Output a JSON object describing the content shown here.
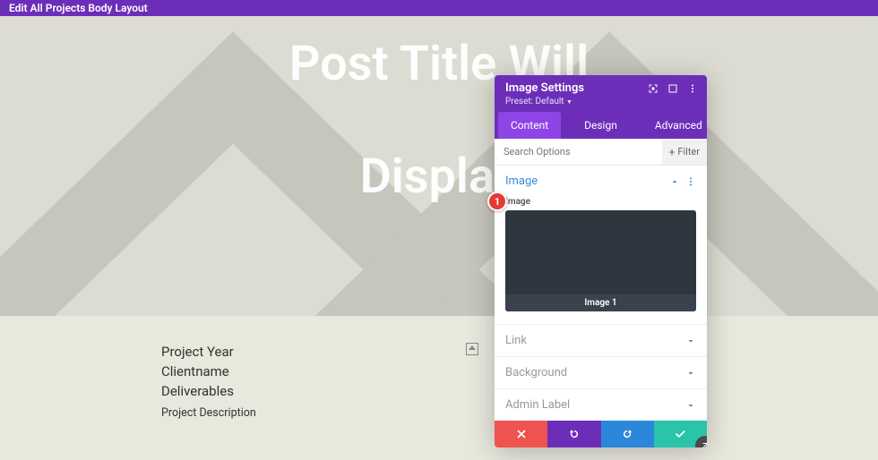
{
  "topbar": {
    "title": "Edit All Projects Body Layout"
  },
  "hero": {
    "line1": "Post Title Will",
    "line2": "Display "
  },
  "meta": {
    "year": "Project Year",
    "client": "Clientname",
    "deliverables": "Deliverables",
    "description": "Project Description"
  },
  "panel": {
    "title": "Image Settings",
    "preset": "Preset: Default",
    "tabs": {
      "content": "Content",
      "design": "Design",
      "advanced": "Advanced"
    },
    "search_placeholder": "Search Options",
    "filter": "Filter",
    "sections": {
      "image": "Image",
      "link": "Link",
      "background": "Background",
      "admin": "Admin Label"
    },
    "image_field_label": "Image",
    "image_caption": "Image 1"
  },
  "badge": "1"
}
